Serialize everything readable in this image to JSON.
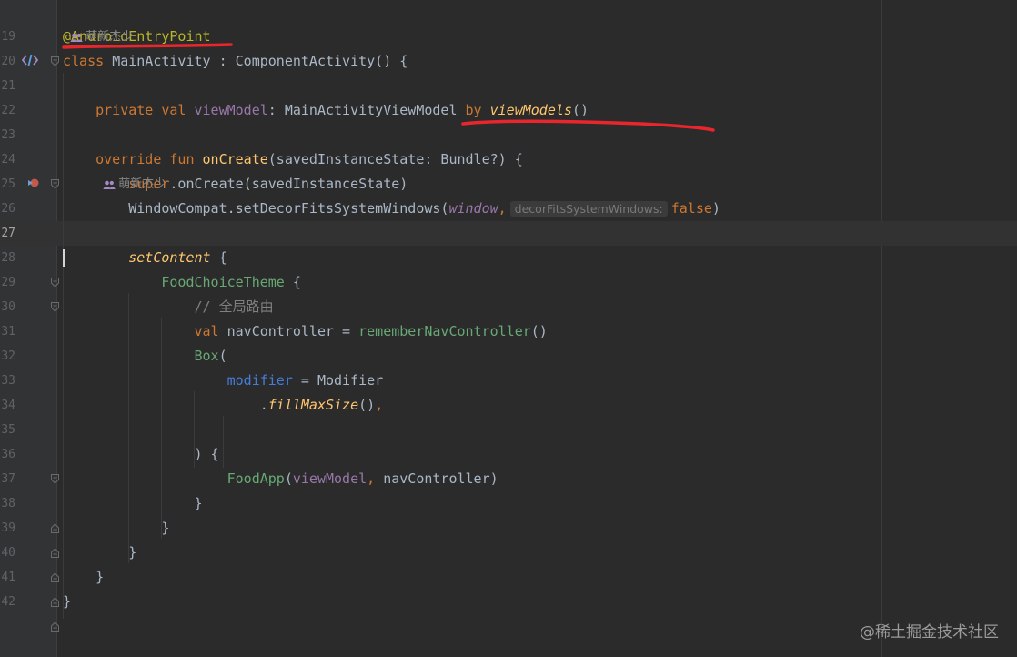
{
  "editor": {
    "author_hints": [
      {
        "text": "萌新杰少"
      },
      {
        "text": "萌新杰少"
      }
    ],
    "lines": [
      {
        "num": "19",
        "tokens": [
          {
            "t": "@AndroidEntryPoint",
            "c": "ann"
          }
        ]
      },
      {
        "num": "20",
        "tokens": [
          {
            "t": "class ",
            "c": "kw"
          },
          {
            "t": "MainActivity : ComponentActivity() {",
            "c": "p"
          }
        ]
      },
      {
        "num": "21",
        "tokens": []
      },
      {
        "num": "22",
        "tokens": [
          {
            "t": "    private val ",
            "c": "kw"
          },
          {
            "t": "viewModel",
            "c": "prop"
          },
          {
            "t": ": MainActivityViewModel ",
            "c": "p"
          },
          {
            "t": "by ",
            "c": "kw"
          },
          {
            "t": "viewModels",
            "c": "ext"
          },
          {
            "t": "()",
            "c": "p"
          }
        ]
      },
      {
        "num": "23",
        "tokens": []
      },
      {
        "num": "24",
        "tokens": [
          {
            "t": "    override fun ",
            "c": "kw"
          },
          {
            "t": "onCreate",
            "c": "fnd"
          },
          {
            "t": "(savedInstanceState: Bundle?) {",
            "c": "p"
          }
        ]
      },
      {
        "num": "25",
        "tokens": [
          {
            "t": "        super",
            "c": "kw"
          },
          {
            "t": ".onCreate(savedInstanceState)",
            "c": "p"
          }
        ]
      },
      {
        "num": "26",
        "tokens": [
          {
            "t": "        WindowCompat.setDecorFitsSystemWindows(",
            "c": "p"
          },
          {
            "t": "window",
            "c": "propi"
          },
          {
            "t": ",",
            "c": "kw"
          },
          {
            "t": "decorFitsSystemWindows:",
            "c": "hint"
          },
          {
            "t": "false",
            "c": "kw"
          },
          {
            "t": ")",
            "c": "p"
          }
        ]
      },
      {
        "num": "27",
        "tokens": []
      },
      {
        "num": "28",
        "tokens": [
          {
            "t": "        setContent",
            "c": "ext"
          },
          {
            "t": " {",
            "c": "p"
          }
        ]
      },
      {
        "num": "29",
        "tokens": [
          {
            "t": "            FoodChoiceTheme",
            "c": "cmp"
          },
          {
            "t": " {",
            "c": "p"
          }
        ]
      },
      {
        "num": "30",
        "tokens": [
          {
            "t": "                // 全局路由",
            "c": "cm"
          }
        ]
      },
      {
        "num": "31",
        "tokens": [
          {
            "t": "                val ",
            "c": "kw"
          },
          {
            "t": "navController = ",
            "c": "p"
          },
          {
            "t": "rememberNavController",
            "c": "cmp"
          },
          {
            "t": "()",
            "c": "p"
          }
        ]
      },
      {
        "num": "32",
        "tokens": [
          {
            "t": "                Box",
            "c": "cmp"
          },
          {
            "t": "(",
            "c": "p"
          }
        ]
      },
      {
        "num": "33",
        "tokens": [
          {
            "t": "                    modifier",
            "c": "named"
          },
          {
            "t": " = Modifier",
            "c": "p"
          }
        ]
      },
      {
        "num": "34",
        "tokens": [
          {
            "t": "                        .",
            "c": "p"
          },
          {
            "t": "fillMaxSize",
            "c": "ext"
          },
          {
            "t": "()",
            "c": "p"
          },
          {
            "t": ",",
            "c": "kw"
          }
        ]
      },
      {
        "num": "35",
        "tokens": []
      },
      {
        "num": "36",
        "tokens": [
          {
            "t": "                ) {",
            "c": "p"
          }
        ]
      },
      {
        "num": "37",
        "tokens": [
          {
            "t": "                    FoodApp",
            "c": "cmp"
          },
          {
            "t": "(",
            "c": "p"
          },
          {
            "t": "viewModel",
            "c": "prop"
          },
          {
            "t": ",",
            "c": "kw"
          },
          {
            "t": " navController)",
            "c": "p"
          }
        ]
      },
      {
        "num": "38",
        "tokens": [
          {
            "t": "                }",
            "c": "p"
          }
        ]
      },
      {
        "num": "39",
        "tokens": [
          {
            "t": "            }",
            "c": "p"
          }
        ]
      },
      {
        "num": "40",
        "tokens": [
          {
            "t": "        }",
            "c": "p"
          }
        ]
      },
      {
        "num": "41",
        "tokens": [
          {
            "t": "    }",
            "c": "p"
          }
        ]
      },
      {
        "num": "42",
        "tokens": [
          {
            "t": "}",
            "c": "p"
          }
        ]
      }
    ],
    "current_line": "27",
    "icons": {
      "line_20": "activity-tag-icon",
      "line_24": "override-marker-icon",
      "author": "author-people-icon"
    },
    "colors": {
      "background": "#2b2b2b",
      "gutter": "#313335",
      "keyword": "#cc7832",
      "annotation": "#bbb529",
      "function": "#ffc66d",
      "property": "#9876aa",
      "composable": "#67a874",
      "named_arg": "#467cda",
      "text": "#a9b7c6",
      "highlight_red": "#e8262c"
    }
  },
  "watermark": "@稀土掘金技术社区"
}
